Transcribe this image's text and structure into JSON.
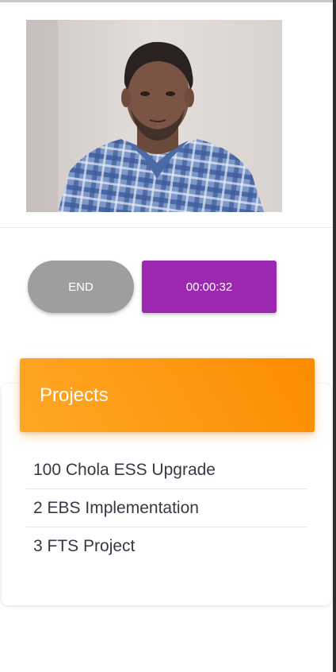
{
  "call_controls": {
    "end_label": "END",
    "timer": "00:00:32"
  },
  "projects": {
    "title": "Projects",
    "items": [
      {
        "label": "100 Chola ESS Upgrade"
      },
      {
        "label": "2 EBS Implementation"
      },
      {
        "label": "3 FTS Project"
      }
    ]
  },
  "colors": {
    "end_button": "#9e9e9e",
    "timer_badge": "#9c27b0",
    "header_gradient_start": "#ffa726",
    "header_gradient_end": "#fb8c00"
  },
  "icons": {
    "video": "camera-feed-person"
  }
}
